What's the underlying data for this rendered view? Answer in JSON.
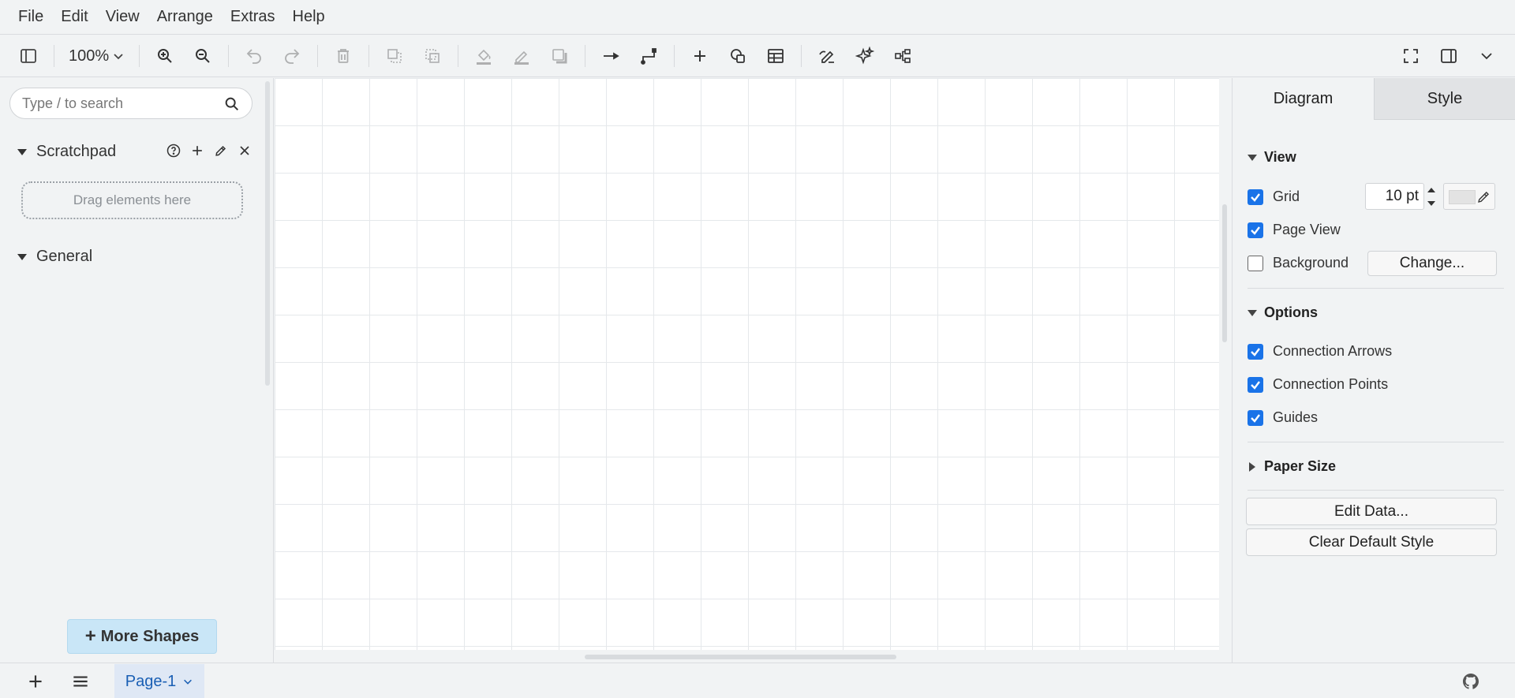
{
  "menu": [
    "File",
    "Edit",
    "View",
    "Arrange",
    "Extras",
    "Help"
  ],
  "toolbar": {
    "zoom_level": "100%",
    "icons": [
      "sidebar-toggle-icon",
      "zoom-in-icon",
      "zoom-out-icon",
      "undo-icon",
      "redo-icon",
      "delete-icon",
      "to-front-icon",
      "to-back-icon",
      "fill-color-icon",
      "line-color-icon",
      "shadow-icon",
      "connection-icon",
      "waypoints-icon",
      "insert-icon",
      "shapes-icon",
      "table-icon",
      "freehand-icon",
      "ai-generate-icon",
      "layout-icon",
      "fullscreen-icon",
      "format-panel-icon",
      "collapse-icon"
    ]
  },
  "sidebar": {
    "search_placeholder": "Type / to search",
    "scratchpad_title": "Scratchpad",
    "dropzone_text": "Drag elements here",
    "general_title": "General",
    "more_shapes_label": "More Shapes"
  },
  "panel": {
    "tabs": [
      "Diagram",
      "Style"
    ],
    "view_section": "View",
    "grid_label": "Grid",
    "grid_checked": true,
    "grid_size": "10 pt",
    "page_view_label": "Page View",
    "page_view_checked": true,
    "background_label": "Background",
    "background_checked": false,
    "change_button": "Change...",
    "options_section": "Options",
    "connection_arrows_label": "Connection Arrows",
    "connection_points_label": "Connection Points",
    "guides_label": "Guides",
    "paper_size_section": "Paper Size",
    "edit_data_button": "Edit Data...",
    "clear_style_button": "Clear Default Style",
    "accent_color": "#1a73e8"
  },
  "bottom": {
    "page_tab": "Page-1"
  }
}
